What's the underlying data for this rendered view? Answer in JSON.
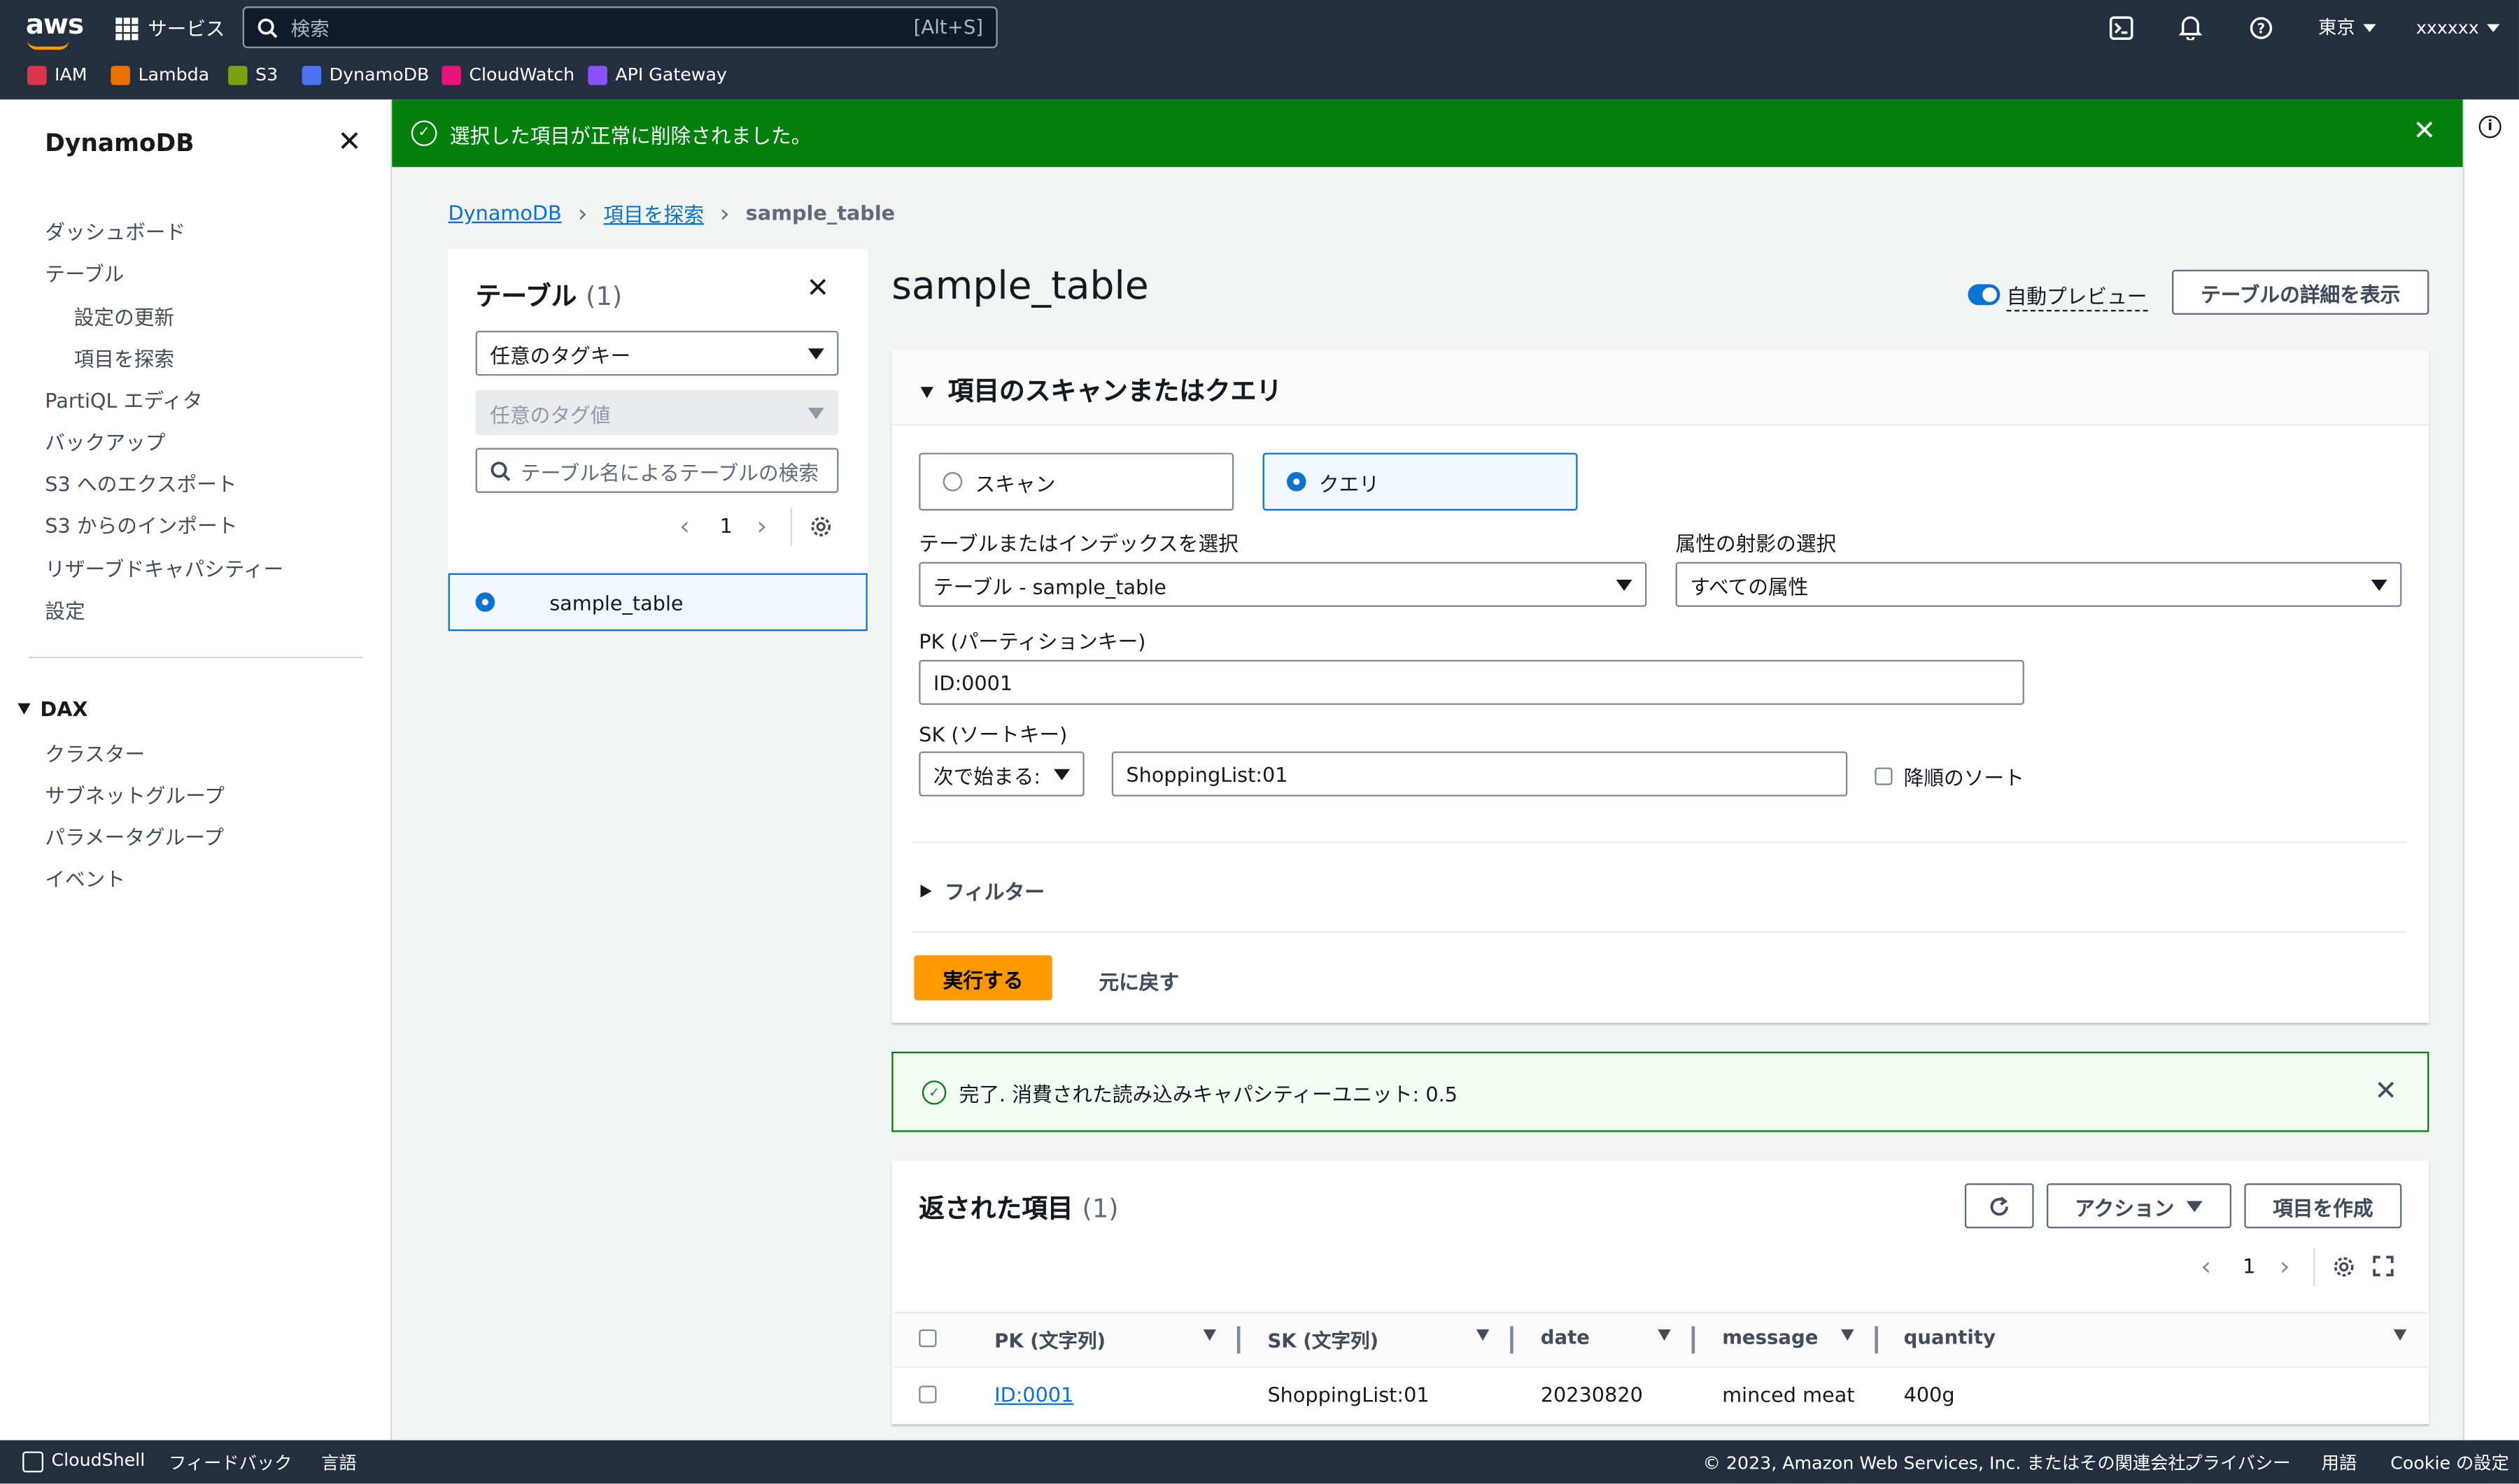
{
  "topnav": {
    "logo": "aws",
    "services": "サービス",
    "search_placeholder": "検索",
    "search_shortcut": "[Alt+S]",
    "region": "東京",
    "account": "xxxxxx"
  },
  "favorites": [
    {
      "label": "IAM",
      "color": "#dd344c"
    },
    {
      "label": "Lambda",
      "color": "#ed7100"
    },
    {
      "label": "S3",
      "color": "#7aa116"
    },
    {
      "label": "DynamoDB",
      "color": "#4d72f3"
    },
    {
      "label": "CloudWatch",
      "color": "#e7157b"
    },
    {
      "label": "API Gateway",
      "color": "#8c4fff"
    }
  ],
  "sidebar": {
    "title": "DynamoDB",
    "items": [
      "ダッシュボード",
      "テーブル",
      "設定の更新",
      "項目を探索",
      "PartiQL エディタ",
      "バックアップ",
      "S3 へのエクスポート",
      "S3 からのインポート",
      "リザーブドキャパシティー",
      "設定"
    ],
    "dax_title": "DAX",
    "dax_items": [
      "クラスター",
      "サブネットグループ",
      "パラメータグループ",
      "イベント"
    ]
  },
  "flash": {
    "message": "選択した項目が正常に削除されました。"
  },
  "breadcrumb": {
    "root": "DynamoDB",
    "middle": "項目を探索",
    "current": "sample_table"
  },
  "tables_panel": {
    "title": "テーブル",
    "count": "(1)",
    "tag_key": "任意のタグキー",
    "tag_value": "任意のタグ値",
    "search_placeholder": "テーブル名によるテーブルの検索",
    "page": "1",
    "table_name": "sample_table"
  },
  "main": {
    "title": "sample_table",
    "auto_preview": "自動プレビュー",
    "details_button": "テーブルの詳細を表示",
    "section_title": "項目のスキャンまたはクエリ",
    "scan_label": "スキャン",
    "query_label": "クエリ",
    "table_index_label": "テーブルまたはインデックスを選択",
    "table_index_value": "テーブル - sample_table",
    "projection_label": "属性の射影の選択",
    "projection_value": "すべての属性",
    "pk_label": "PK (パーティションキー)",
    "pk_value": "ID:0001",
    "sk_label": "SK (ソートキー)",
    "sk_operator": "次で始まる:",
    "sk_value": "ShoppingList:01",
    "desc_sort": "降順のソート",
    "filter_label": "フィルター",
    "run_button": "実行する",
    "reset_button": "元に戻す"
  },
  "success": {
    "message": "完了. 消費された読み込みキャパシティーユニット: 0.5"
  },
  "results": {
    "title": "返された項目",
    "count": "(1)",
    "actions_button": "アクション",
    "create_button": "項目を作成",
    "page": "1",
    "columns": [
      "PK (文字列)",
      "SK (文字列)",
      "date",
      "message",
      "quantity"
    ],
    "rows": [
      {
        "pk": "ID:0001",
        "sk": "ShoppingList:01",
        "date": "20230820",
        "message": "minced meat",
        "quantity": "400g"
      }
    ]
  },
  "footer": {
    "cloudshell": "CloudShell",
    "feedback": "フィードバック",
    "language": "言語",
    "copyright": "© 2023, Amazon Web Services, Inc. またはその関連会社。",
    "privacy": "プライバシー",
    "terms": "用語",
    "cookie": "Cookie の設定"
  }
}
